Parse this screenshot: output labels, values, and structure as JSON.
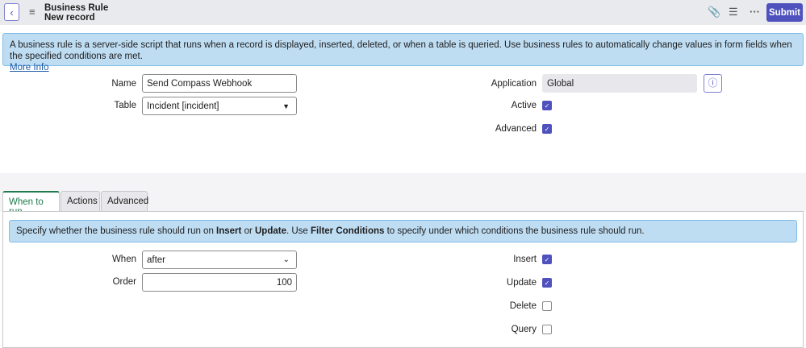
{
  "header": {
    "title": "Business Rule",
    "subtitle": "New record",
    "submit": "Submit"
  },
  "info_banner": {
    "text": "A business rule is a server-side script that runs when a record is displayed, inserted, deleted, or when a table is queried. Use business rules to automatically change values in form fields when the specified conditions are met.",
    "link": "More Info"
  },
  "form": {
    "name_label": "Name",
    "name_value": "Send Compass Webhook",
    "table_label": "Table",
    "table_value": "Incident [incident]",
    "application_label": "Application",
    "application_value": "Global",
    "active_label": "Active",
    "active": true,
    "advanced_label": "Advanced",
    "advanced": true
  },
  "tabs": [
    {
      "label": "When to run",
      "active": true
    },
    {
      "label": "Actions"
    },
    {
      "label": "Advanced"
    }
  ],
  "when_to_run": {
    "info_parts": [
      "Specify whether the business rule should run on ",
      "Insert",
      " or ",
      "Update",
      ". Use ",
      "Filter Conditions",
      " to specify under which conditions the business rule should run."
    ],
    "when_label": "When",
    "when_value": "after",
    "order_label": "Order",
    "order_value": "100",
    "insert_label": "Insert",
    "insert": true,
    "update_label": "Update",
    "update": true,
    "delete_label": "Delete",
    "delete": false,
    "query_label": "Query",
    "query": false
  }
}
